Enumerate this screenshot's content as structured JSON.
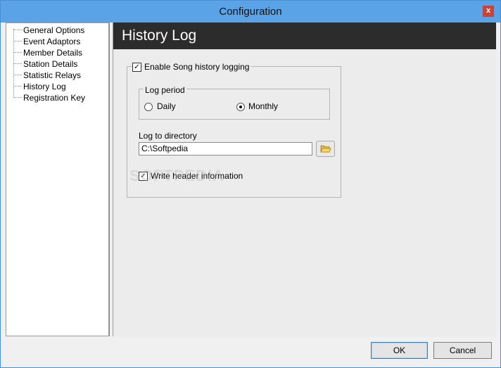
{
  "window": {
    "title": "Configuration",
    "close_glyph": "x"
  },
  "tree": {
    "items": [
      {
        "label": "General Options"
      },
      {
        "label": "Event Adaptors"
      },
      {
        "label": "Member Details"
      },
      {
        "label": "Station Details"
      },
      {
        "label": "Statistic Relays"
      },
      {
        "label": "History Log"
      },
      {
        "label": "Registration Key"
      }
    ]
  },
  "panel": {
    "title": "History Log",
    "enable_logging": {
      "label": "Enable Song history logging",
      "checked": true
    },
    "log_period": {
      "label": "Log period",
      "options": [
        {
          "label": "Daily",
          "selected": false
        },
        {
          "label": "Monthly",
          "selected": true
        }
      ]
    },
    "directory": {
      "label": "Log to directory",
      "value": "C:\\Softpedia"
    },
    "write_header": {
      "label": "Write header information",
      "checked": true
    },
    "watermark": "SOFTPEDIA"
  },
  "buttons": {
    "ok": "OK",
    "cancel": "Cancel"
  },
  "colors": {
    "titlebar": "#5aa3e6",
    "header": "#2c2c2c",
    "close": "#c7433c"
  },
  "icons": {
    "folder": "folder-open-icon",
    "check": "check-icon"
  }
}
